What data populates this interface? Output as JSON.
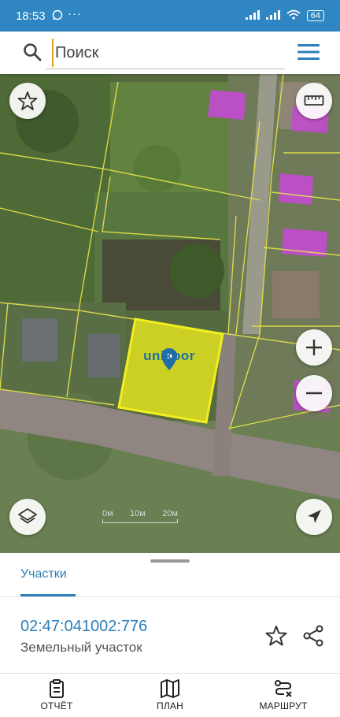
{
  "status_bar": {
    "time": "18:53",
    "battery": "64",
    "dots": "···"
  },
  "search": {
    "placeholder": "Поиск",
    "value": ""
  },
  "map": {
    "logo_text": "unikoor",
    "scale_labels": [
      "0м",
      "10м",
      "20м"
    ],
    "highlight_color": "#e6e61e",
    "accent": "#2f7fb8"
  },
  "sheet": {
    "tab_label": "Участки",
    "parcel_number": "02:47:041002:776",
    "parcel_type": "Земельный участок"
  },
  "nav": {
    "items": [
      {
        "label": "ОТЧЁТ",
        "icon": "clipboard-icon"
      },
      {
        "label": "ПЛАН",
        "icon": "map-icon"
      },
      {
        "label": "МАРШРУТ",
        "icon": "route-icon"
      }
    ]
  }
}
